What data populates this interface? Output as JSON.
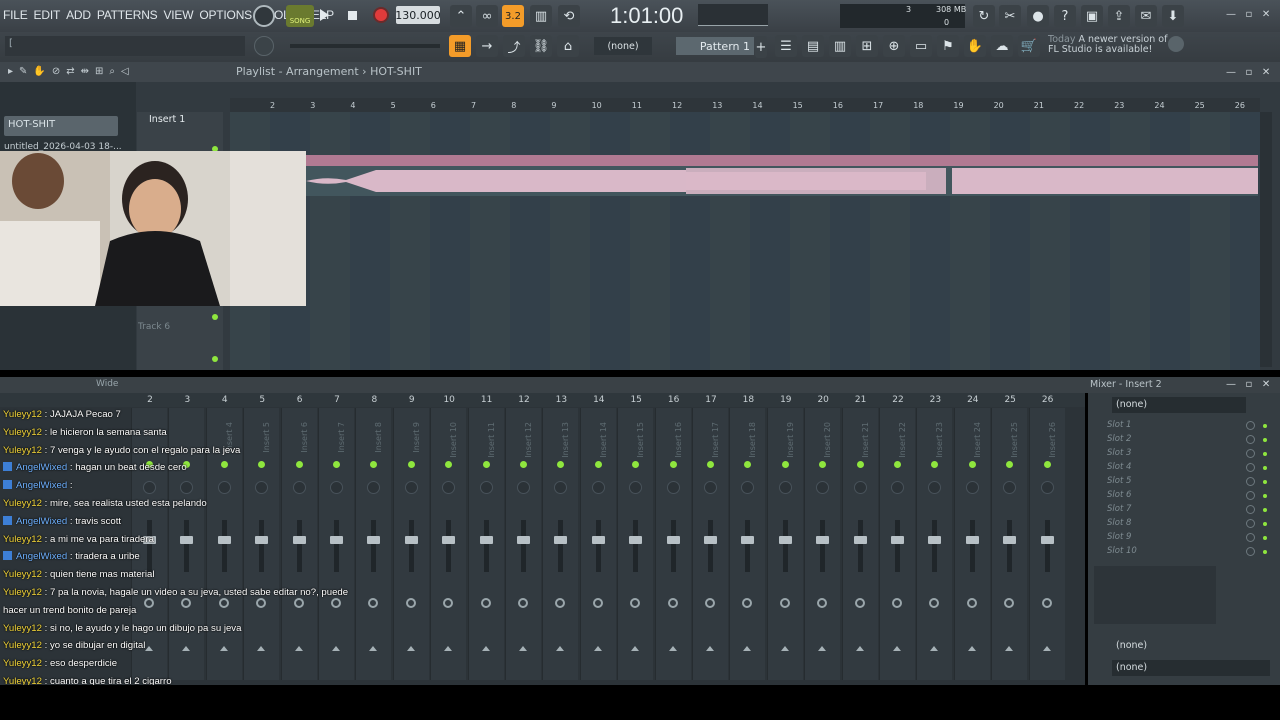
{
  "menu": [
    "FILE",
    "EDIT",
    "ADD",
    "PATTERNS",
    "VIEW",
    "OPTIONS",
    "TOOLS",
    "HELP"
  ],
  "transport": {
    "song_label": "SONG",
    "tempo": "130.000",
    "time": "1:01:00",
    "cpu": "3",
    "memory": "308 MB",
    "polyphony": "0"
  },
  "toolbar": {
    "pattern_label": "Pattern 1",
    "snap_none": "(none)"
  },
  "news": {
    "line1_prefix": "Today",
    "line1": "A newer version of",
    "line2": "FL Studio is available!"
  },
  "playlist": {
    "title_main": "Playlist - Arrangement",
    "title_sep": "›",
    "title_pattern": "HOT-SHIT",
    "pattern_panel": "HOT-SHIT",
    "clip_name": "untitled_2026-04-03 18-...",
    "insert_label": "Insert 1",
    "track6": "Track 6",
    "ruler": [
      "2",
      "3",
      "4",
      "5",
      "6",
      "7",
      "8",
      "9",
      "10",
      "11",
      "12",
      "13",
      "14",
      "15",
      "16",
      "17",
      "18",
      "19",
      "20",
      "21",
      "22",
      "23",
      "24",
      "25",
      "26"
    ]
  },
  "mixer": {
    "header_label": "Wide",
    "panel_title": "Mixer - Insert 2",
    "top_select": "(none)",
    "bottom_select1": "(none)",
    "bottom_select2": "(none)",
    "strip_nums": [
      "2",
      "3",
      "4",
      "5",
      "6",
      "7",
      "8",
      "9",
      "10",
      "11",
      "12",
      "13",
      "14",
      "15",
      "16",
      "17",
      "18",
      "19",
      "20",
      "21",
      "22",
      "23",
      "24",
      "25",
      "26"
    ],
    "strip_names": [
      "",
      "",
      "Insert 4",
      "Insert 5",
      "Insert 6",
      "Insert 7",
      "Insert 8",
      "Insert 9",
      "Insert 10",
      "Insert 11",
      "Insert 12",
      "Insert 13",
      "Insert 14",
      "Insert 15",
      "Insert 16",
      "Insert 17",
      "Insert 18",
      "Insert 19",
      "Insert 20",
      "Insert 21",
      "Insert 22",
      "Insert 23",
      "Insert 24",
      "Insert 25",
      "Insert 26"
    ],
    "slots": [
      "Slot 1",
      "Slot 2",
      "Slot 3",
      "Slot 4",
      "Slot 5",
      "Slot 6",
      "Slot 7",
      "Slot 8",
      "Slot 9",
      "Slot 10"
    ]
  },
  "chat": [
    {
      "user": "Yuleyy12",
      "type": "y",
      "text": "JAJAJA Pecao 7"
    },
    {
      "user": "Yuleyy12",
      "type": "y",
      "text": "le hicieron la semana santa"
    },
    {
      "user": "Yuleyy12",
      "type": "y",
      "text": "7 venga y le ayudo con el regalo para la jeva"
    },
    {
      "user": "AngelWixed",
      "type": "a",
      "text": "hagan un beat desde cero"
    },
    {
      "user": "AngelWixed",
      "type": "a",
      "text": ""
    },
    {
      "user": "Yuleyy12",
      "type": "y",
      "text": "mire, sea realista usted esta pelando"
    },
    {
      "user": "AngelWixed",
      "type": "a",
      "text": "travis scott"
    },
    {
      "user": "Yuleyy12",
      "type": "y",
      "text": "a mi me va para tiradera"
    },
    {
      "user": "AngelWixed",
      "type": "a",
      "text": "tiradera a uribe"
    },
    {
      "user": "Yuleyy12",
      "type": "y",
      "text": "quien tiene mas material"
    },
    {
      "user": "Yuleyy12",
      "type": "y",
      "text": "7 pa la novia, hagale un video a su jeva, usted sabe editar no?, puede"
    },
    {
      "user": "",
      "type": "c",
      "text": "hacer un trend bonito de pareja"
    },
    {
      "user": "Yuleyy12",
      "type": "y",
      "text": "si no, le ayudo y le hago un dibujo pa su jeva"
    },
    {
      "user": "Yuleyy12",
      "type": "y",
      "text": "yo se dibujar en digital"
    },
    {
      "user": "Yuleyy12",
      "type": "y",
      "text": "eso desperdicie"
    },
    {
      "user": "Yuleyy12",
      "type": "y",
      "text": "cuanto a que tira el 2 cigarro"
    }
  ]
}
